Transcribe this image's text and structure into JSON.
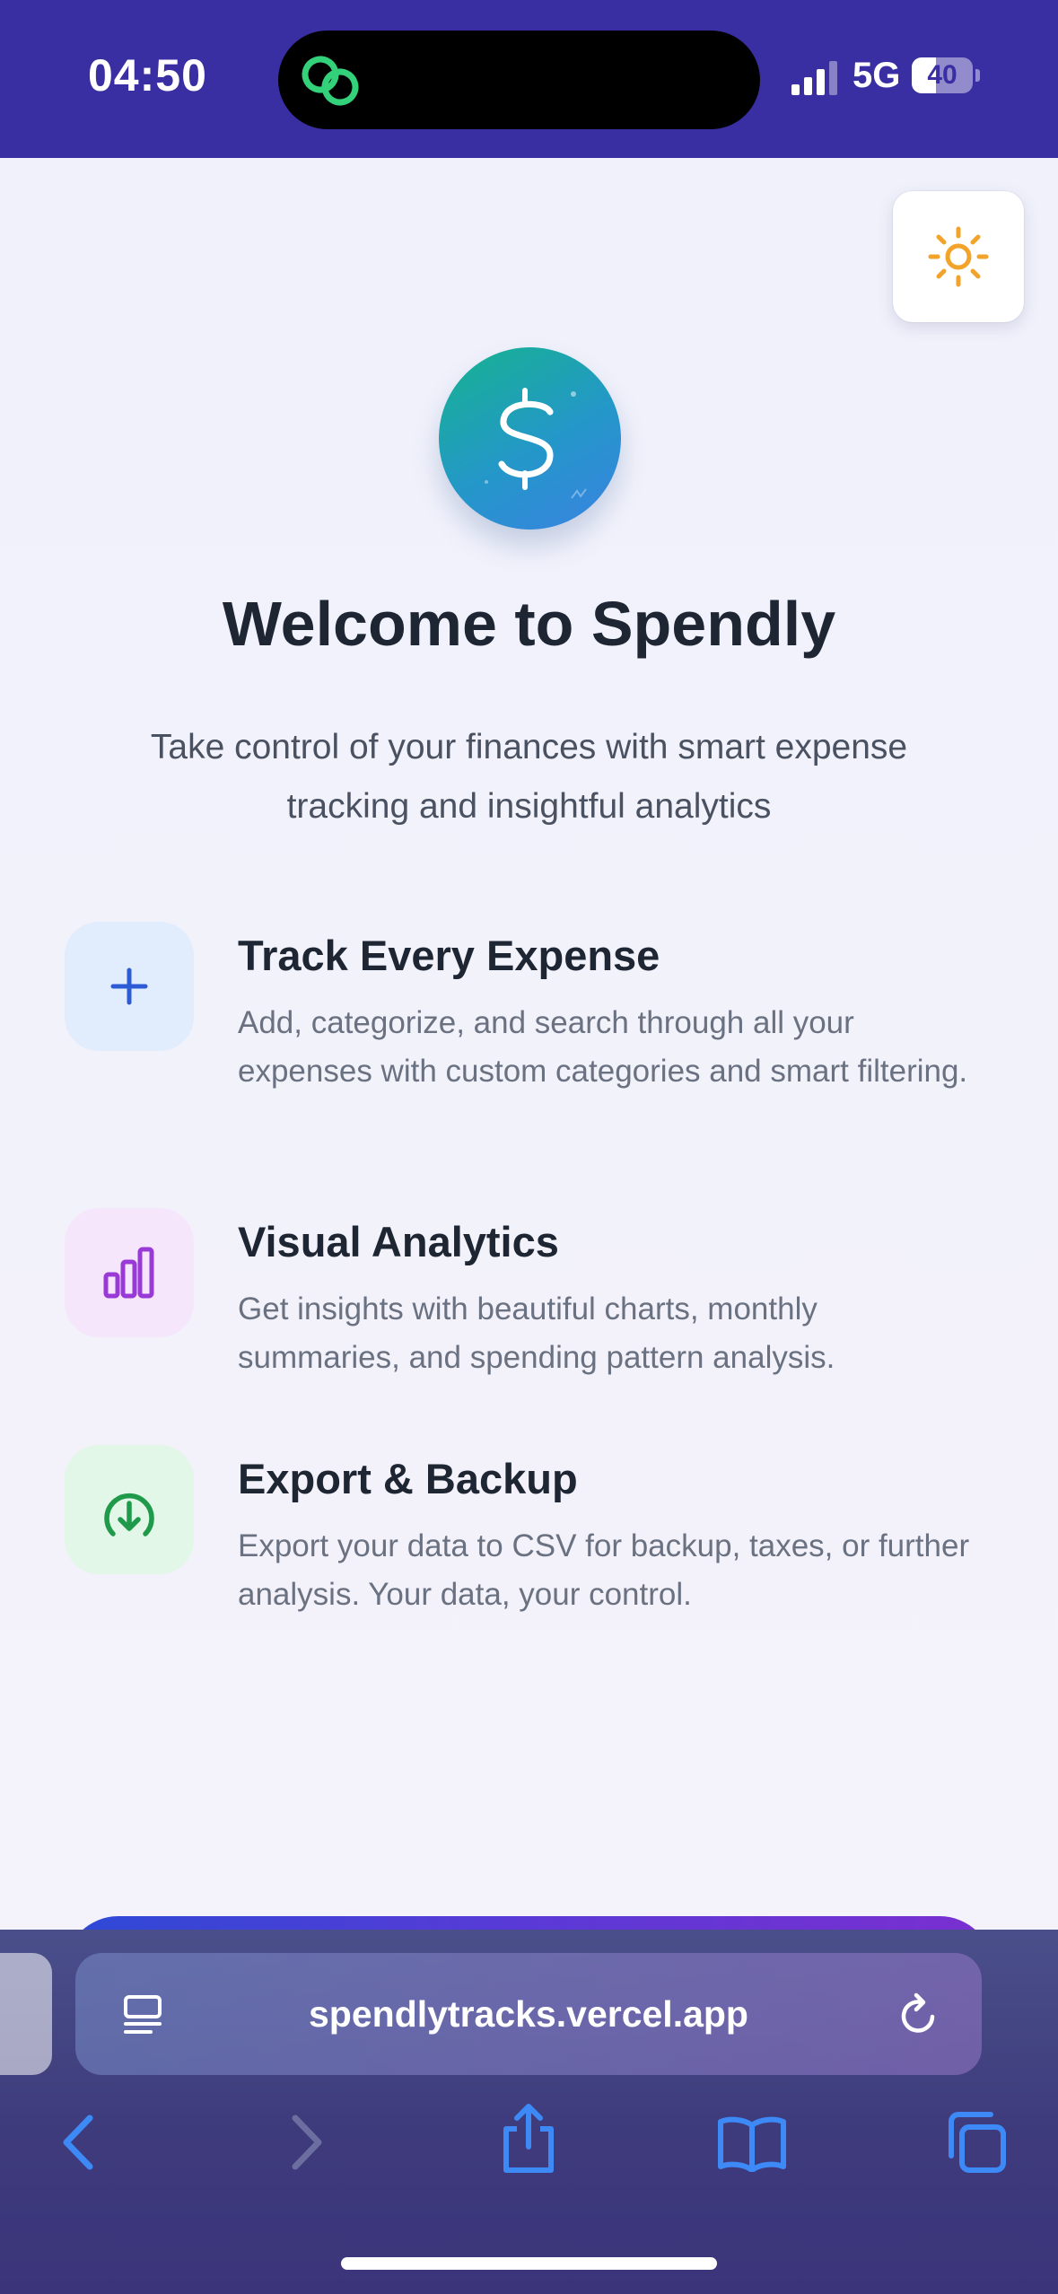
{
  "status_bar": {
    "time": "04:50",
    "network": "5G",
    "battery_level": 40,
    "battery_text": "40",
    "signal_bars": 3,
    "colors": {
      "background": "#3a2ea3"
    }
  },
  "header": {
    "theme_toggle_icon": "sun-icon",
    "accent_color": "#f2a32a"
  },
  "hero": {
    "logo_icon": "dollar-sign-icon",
    "title": "Welcome to Spendly",
    "subtitle": "Take control of your finances with smart expense tracking and insightful analytics"
  },
  "features": [
    {
      "icon": "plus-icon",
      "icon_color": "#2d5bd6",
      "icon_bg": "#e1ecfc",
      "title": "Track Every Expense",
      "description": "Add, categorize, and search through all your expenses with custom categories and smart filtering."
    },
    {
      "icon": "bar-chart-icon",
      "icon_color": "#9a3ad6",
      "icon_bg": "#f6e6fb",
      "title": "Visual Analytics",
      "description": "Get insights with beautiful charts, monthly summaries, and spending pattern analysis."
    },
    {
      "icon": "download-circle-icon",
      "icon_color": "#1f9a4a",
      "icon_bg": "#e2f7e7",
      "title": "Export & Backup",
      "description": "Export your data to CSV for backup, taxes, or further analysis. Your data, your control."
    }
  ],
  "browser": {
    "url": "spendlytracks.vercel.app",
    "back_enabled": true,
    "forward_enabled": false
  }
}
